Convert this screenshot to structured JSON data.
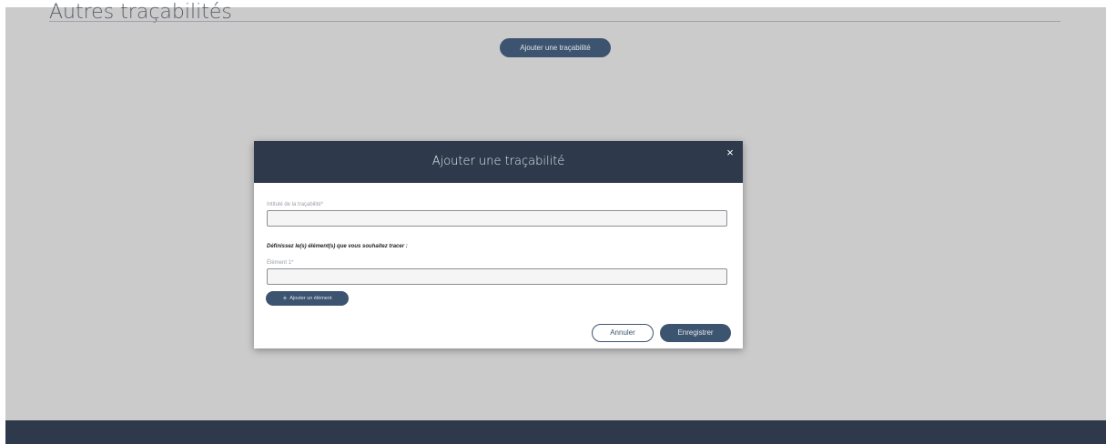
{
  "page": {
    "section_title": "Autres traçabilités",
    "add_trace_button": "Ajouter une traçabilité"
  },
  "modal": {
    "title": "Ajouter une traçabilité",
    "close_icon": "close-icon",
    "close_glyph": "×",
    "name_label": "Intitulé de la traçabilité*",
    "name_value": "",
    "define_text": "Définissez le(s) élément(s) que vous souhaitez tracer :",
    "element_label": "Élément 1*",
    "element_value": "",
    "add_element_glyph": "+",
    "add_element_label": "Ajouter un élément",
    "cancel_label": "Annuler",
    "save_label": "Enregistrer"
  },
  "colors": {
    "overlay_background": "#cbcbcb",
    "header_background": "#2e3a4b",
    "primary_button": "#3d5470"
  }
}
